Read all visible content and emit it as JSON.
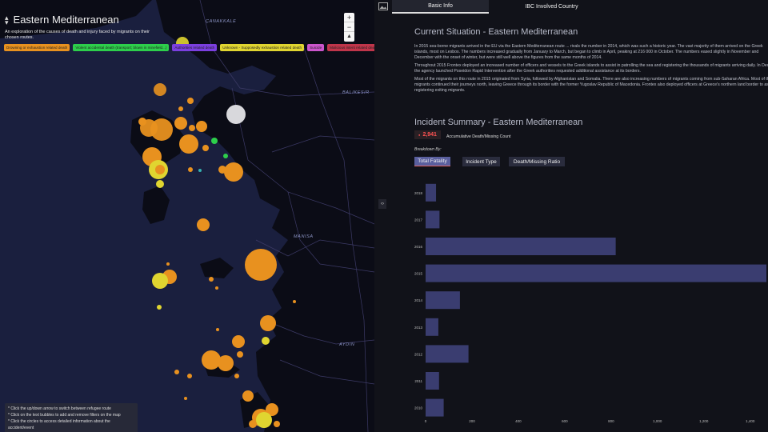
{
  "map": {
    "route_title": "Eastern Mediterranean",
    "route_description": "An exploration of the causes of death and injury faced by migrants on their chosen routes.",
    "chips": [
      {
        "label": "Drowning or exhaustion related death",
        "color": "#e8911f"
      },
      {
        "label": "Violent accidental death (transport; blown in minefield...)",
        "color": "#2dcf4b"
      },
      {
        "label": "Authorities related death",
        "color": "#7b3fe0"
      },
      {
        "label": "Unknown - Supposedly exhaustion related death",
        "color": "#e0d530"
      },
      {
        "label": "Suicide",
        "color": "#cc55cc"
      },
      {
        "label": "Malicious intent related death / Manslaughter",
        "color": "#c0354a"
      },
      {
        "label": "",
        "color": "#35b0b0"
      }
    ],
    "zoom_in": "+",
    "zoom_out": "−",
    "compass": "▲",
    "places": [
      "ÇANAKKALE",
      "BALIKESIR",
      "MANISA",
      "AYDIN"
    ],
    "instructions": [
      "* Click the up/down arrow to switch between refugee route",
      "* Click on the text bubbles to add and remove filters on the map",
      "* Click the circles to access detailed information about the accident/event"
    ]
  },
  "tabs": {
    "active": "Basic Info",
    "other": "IBC Involved Country"
  },
  "collapse_handle": "‹›",
  "situation": {
    "title": "Current Situation - Eastern Mediterranean",
    "para1": [
      "In 2015 sea-borne migrants arrived in the EU via the Eastern Mediterranean route ... rivals the number in 2014, which was such a historic year. The vast majority of them arrived on the Greek",
      "islands, most on Lesbos. The numbers increased gradually from January to March, but began to climb in April, peaking at 216 000 in October. The numbers eased slightly in November and",
      "December with the onset of winter, but were still well above the figures from the same months of 2014."
    ],
    "para2": [
      "Throughout 2015 Frontex deployed an increased number of officers and vessels to the Greek islands to assist in patrolling the sea and registering the thousands of migrants arriving daily. In December",
      "the agency launched Poseidon Rapid Intervention after the Greek authorities requested additional assistance at its borders."
    ],
    "para3": [
      "Most of the migrants on this route in 2015 originated from Syria, followed by Afghanistan and Somalia. There are also increasing numbers of migrants coming from sub-Saharan Africa. Most of the",
      "migrants continued their journeys north, leaving Greece through its border with the former Yugoslav Republic of Macedonia. Frontex also deployed officers at Greece's northern land border to assist in",
      "registering exiting migrants."
    ]
  },
  "summary": {
    "title": "Incident Summary - Eastern Mediterranean",
    "count": "2,941",
    "count_label": "Accumulative Death/Missing Count",
    "breakdown_label": "Breakdown By:",
    "buttons": [
      "Total Fatality",
      "Incident Type",
      "Death/Missing Ratio"
    ],
    "selected": "Total Fatality"
  },
  "chart_data": {
    "type": "bar",
    "orientation": "horizontal",
    "categories": [
      "2018",
      "2017",
      "2016",
      "2015",
      "2014",
      "2013",
      "2012",
      "2011",
      "2010"
    ],
    "values": [
      45,
      60,
      820,
      1470,
      148,
      55,
      185,
      58,
      78
    ],
    "xticks": [
      0,
      200,
      400,
      600,
      800,
      1000,
      1200,
      1400
    ],
    "xtick_labels": [
      "0",
      "200",
      "400",
      "600",
      "800",
      "1,000",
      "1,200",
      "1,400"
    ],
    "xlim": [
      0,
      1470
    ],
    "bar_color": "#3a3d70"
  }
}
